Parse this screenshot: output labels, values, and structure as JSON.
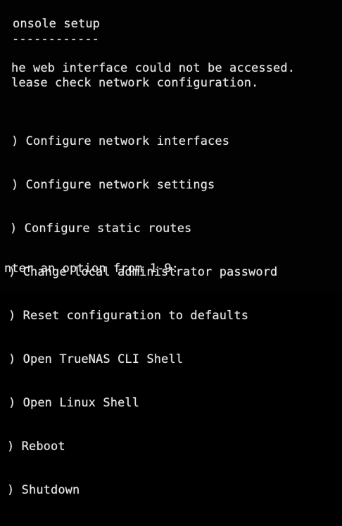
{
  "console": {
    "title": "onsole setup",
    "title_underline": "------------",
    "message_line1": "he web interface could not be accessed.",
    "message_line2": "lease check network configuration.",
    "menu": [
      {
        "text": ") Configure network interfaces",
        "indent": 16
      },
      {
        "text": ") Configure network settings",
        "indent": 16
      },
      {
        "text": ") Configure static routes",
        "indent": 14
      },
      {
        "text": ") Change local administrator password",
        "indent": 12
      },
      {
        "text": ") Reset configuration to defaults",
        "indent": 12
      },
      {
        "text": ") Open TrueNAS CLI Shell",
        "indent": 12
      },
      {
        "text": ") Open Linux Shell",
        "indent": 12
      },
      {
        "text": ") Reboot",
        "indent": 10
      },
      {
        "text": ") Shutdown",
        "indent": 10
      }
    ],
    "prompt": "nter an option from 1-9:"
  },
  "colors": {
    "background": "#020202",
    "foreground": "#e8e8e8"
  }
}
